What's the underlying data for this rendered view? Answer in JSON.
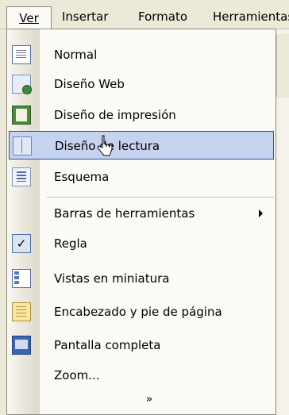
{
  "menubar": {
    "items": [
      {
        "label": "Ver"
      },
      {
        "label": "Insertar"
      },
      {
        "label": "Formato"
      },
      {
        "label": "Herramientas"
      }
    ]
  },
  "menu": {
    "items": [
      {
        "label": "Normal",
        "icon": "normal-view-icon"
      },
      {
        "label": "Diseño Web",
        "icon": "web-layout-icon"
      },
      {
        "label": "Diseño de impresión",
        "icon": "print-layout-icon"
      },
      {
        "label": "Diseño de lectura",
        "icon": "reading-layout-icon",
        "highlighted": true
      },
      {
        "label": "Esquema",
        "icon": "outline-icon"
      },
      {
        "label": "Barras de herramientas",
        "has_submenu": true
      },
      {
        "label": "Regla",
        "checked": true,
        "icon": "check-icon"
      },
      {
        "label": "Vistas en miniatura",
        "icon": "thumbnails-icon"
      },
      {
        "label": "Encabezado y pie de página",
        "icon": "header-footer-icon"
      },
      {
        "label": "Pantalla completa",
        "icon": "full-screen-icon"
      },
      {
        "label": "Zoom..."
      }
    ],
    "expand_glyph": "»"
  },
  "colors": {
    "highlight_bg": "#c6d3ef",
    "highlight_border": "#2f4f9b",
    "menu_bg": "#fbfaf7",
    "bar_bg": "#ece9d8"
  }
}
